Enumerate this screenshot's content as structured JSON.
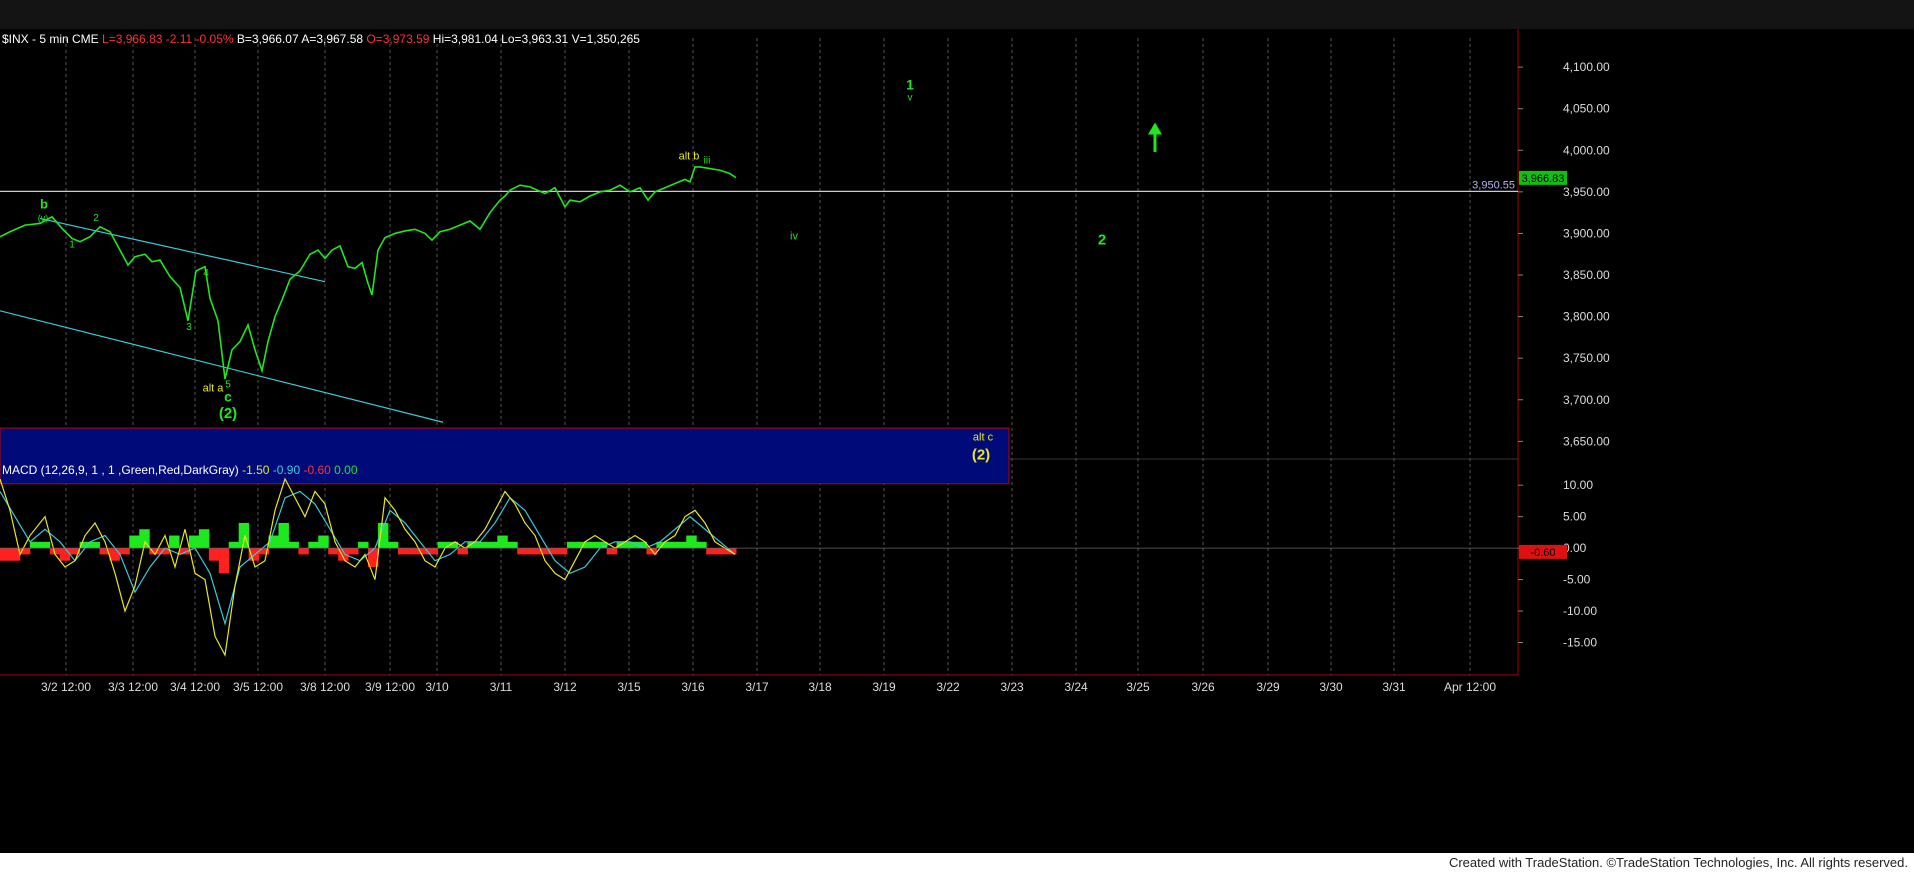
{
  "header": {
    "symbol": "$INX - 5 min  CME",
    "last": "L=3,966.83",
    "change": "-2.11",
    "change_pct": "-0.05%",
    "bid": "B=3,966.07",
    "ask": "A=3,967.58",
    "open": "O=3,973.59",
    "high": "Hi=3,981.04",
    "low": "Lo=3,963.31",
    "volume": "V=1,350,265"
  },
  "macd_header": {
    "name": "MACD (12,26,9, 1 , 1 ,Green,Red,DarkGray)",
    "v1": "-1.50",
    "v2": "-0.90",
    "v3": "-0.60",
    "v4": "0.00"
  },
  "footer": "Created with TradeStation. ©TradeStation Technologies, Inc. All rights reserved.",
  "colors": {
    "price": "#1ee81e",
    "yellow": "#e8e820",
    "red": "#ff2020",
    "cyan": "#3cc8dc",
    "hline": "#c8c8dc",
    "blue_zone": "#000a78",
    "blue_zone_border": "#c00000",
    "grid": "#555",
    "axis_text": "#dcdcdc"
  },
  "chart_data": [
    {
      "type": "line",
      "title": "$INX - 5 min",
      "y_ticks": [
        "4,100.00",
        "4,050.00",
        "4,000.00",
        "3,950.00",
        "3,900.00",
        "3,850.00",
        "3,800.00",
        "3,750.00",
        "3,700.00",
        "3,650.00"
      ],
      "ylim": [
        3630,
        4135
      ],
      "x_ticks": [
        "3/2 12:00",
        "3/3 12:00",
        "3/4 12:00",
        "3/5 12:00",
        "3/8 12:00",
        "3/9 12:00",
        "3/10",
        "3/11",
        "3/12",
        "3/15",
        "3/16",
        "3/17",
        "3/18",
        "3/19",
        "3/22",
        "3/23",
        "3/24",
        "3/25",
        "3/26",
        "3/29",
        "3/30",
        "3/31",
        "Apr 12:00"
      ],
      "series": [
        {
          "x": [
            0,
            10,
            25,
            40,
            52,
            62,
            72,
            80,
            90,
            100,
            110,
            120,
            128,
            135,
            145,
            152,
            160,
            170,
            180,
            188,
            196,
            205,
            210,
            218,
            225,
            232,
            240,
            248,
            255,
            262,
            268,
            275,
            282,
            290,
            300,
            310,
            318,
            325,
            332,
            340,
            348,
            355,
            362,
            368,
            372,
            378,
            385,
            395,
            405,
            415,
            425,
            432,
            440,
            450,
            460,
            470,
            480,
            490,
            500,
            505,
            510,
            520,
            530,
            545,
            555,
            565,
            570,
            580,
            590,
            600,
            610,
            620,
            630,
            640,
            648,
            655,
            665,
            675,
            685,
            690,
            695,
            700,
            710,
            720,
            730,
            736
          ],
          "y": [
            3896,
            3902,
            3910,
            3912,
            3920,
            3906,
            3894,
            3890,
            3896,
            3908,
            3902,
            3880,
            3862,
            3872,
            3875,
            3866,
            3868,
            3848,
            3835,
            3795,
            3855,
            3860,
            3822,
            3795,
            3725,
            3760,
            3770,
            3790,
            3760,
            3735,
            3770,
            3800,
            3820,
            3845,
            3855,
            3875,
            3880,
            3870,
            3880,
            3885,
            3860,
            3858,
            3865,
            3840,
            3826,
            3880,
            3895,
            3900,
            3903,
            3905,
            3900,
            3892,
            3902,
            3905,
            3910,
            3915,
            3905,
            3925,
            3940,
            3945,
            3952,
            3958,
            3956,
            3948,
            3955,
            3932,
            3940,
            3938,
            3945,
            3950,
            3952,
            3958,
            3950,
            3955,
            3940,
            3950,
            3955,
            3960,
            3965,
            3962,
            3980,
            3980,
            3978,
            3976,
            3972,
            3967
          ],
          "x_domain": [
            0,
            1515
          ]
        }
      ],
      "horizontal_line": 3950.55,
      "horizontal_line_label": "3,950.55",
      "last_price_label": "3,966.83",
      "channel_lines": [
        {
          "x": [
            40,
            325
          ],
          "y": [
            3918,
            3842
          ]
        },
        {
          "x": [
            0,
            443
          ],
          "y": [
            3807,
            3673
          ]
        }
      ],
      "target_zone": {
        "x": [
          0,
          1009
        ],
        "y": [
          3599,
          3666
        ]
      },
      "annotations": [
        {
          "text": "b",
          "x": 44,
          "y": 3930,
          "color": "green",
          "size": 13
        },
        {
          "text": "(v)",
          "x": 43,
          "y": 3915,
          "color": "green",
          "size": 9
        },
        {
          "text": "1",
          "x": 72,
          "y": 3883,
          "color": "green",
          "size": 10
        },
        {
          "text": "2",
          "x": 96,
          "y": 3915,
          "color": "green",
          "size": 10
        },
        {
          "text": "3",
          "x": 189,
          "y": 3784,
          "color": "green",
          "size": 10
        },
        {
          "text": "4",
          "x": 206,
          "y": 3849,
          "color": "green",
          "size": 10
        },
        {
          "text": "5",
          "x": 228,
          "y": 3715,
          "color": "green",
          "size": 10
        },
        {
          "text": "alt a",
          "x": 213,
          "y": 3710,
          "color": "yellow",
          "size": 11
        },
        {
          "text": "c",
          "x": 228,
          "y": 3698,
          "color": "green",
          "size": 14
        },
        {
          "text": "(2)",
          "x": 228,
          "y": 3678,
          "color": "green",
          "size": 15
        },
        {
          "text": "alt b",
          "x": 689,
          "y": 3989,
          "color": "yellow",
          "size": 11
        },
        {
          "text": "iii",
          "x": 707,
          "y": 3984,
          "color": "green",
          "size": 10
        },
        {
          "text": "iv",
          "x": 794,
          "y": 3893,
          "color": "green",
          "size": 11
        },
        {
          "text": "1",
          "x": 910,
          "y": 4073,
          "color": "green",
          "size": 14
        },
        {
          "text": "v",
          "x": 910,
          "y": 4060,
          "color": "green",
          "size": 10
        },
        {
          "text": "2",
          "x": 1102,
          "y": 3887,
          "color": "green",
          "size": 15
        },
        {
          "text": "alt c",
          "x": 983,
          "y": 3651,
          "color": "yellow",
          "size": 11
        },
        {
          "text": "(2)",
          "x": 981,
          "y": 3628,
          "color": "yellow",
          "size": 15
        }
      ],
      "up_arrow": {
        "x": 1155,
        "y_from": 3998,
        "y_to": 4031
      }
    },
    {
      "type": "line",
      "title": "MACD (12,26,9, 1 , 1 ,Green,Red,DarkGray)",
      "y_ticks": [
        "10.00",
        "5.00",
        "0.00",
        "-5.00",
        "-10.00",
        "-15.00"
      ],
      "ylim": [
        -20,
        14
      ],
      "series": [
        {
          "name": "MACD",
          "x": [
            0,
            10,
            20,
            30,
            45,
            55,
            65,
            75,
            85,
            95,
            105,
            115,
            125,
            135,
            145,
            155,
            165,
            175,
            185,
            195,
            205,
            215,
            225,
            235,
            245,
            255,
            265,
            275,
            285,
            295,
            305,
            315,
            325,
            335,
            345,
            355,
            365,
            375,
            385,
            395,
            405,
            415,
            425,
            435,
            445,
            455,
            465,
            475,
            485,
            495,
            505,
            515,
            525,
            535,
            545,
            555,
            565,
            575,
            585,
            595,
            605,
            615,
            625,
            635,
            645,
            655,
            665,
            675,
            685,
            695,
            705,
            715,
            725,
            735
          ],
          "y": [
            11,
            6,
            -1,
            2,
            5,
            -1,
            -3,
            -2,
            2,
            4,
            1,
            -4,
            -10,
            -6,
            1,
            -1,
            2,
            -3,
            3,
            -4,
            -5,
            -14,
            -17,
            -6,
            2,
            -3,
            -2,
            6,
            11,
            8,
            5,
            9,
            7,
            1,
            -2,
            -3,
            -1,
            -5,
            8,
            6,
            3,
            1,
            -2,
            -3,
            0,
            1,
            0,
            1,
            3,
            6,
            9,
            7,
            4,
            2,
            -2,
            -4,
            -5,
            -2,
            1,
            2,
            1,
            0,
            1,
            2,
            1,
            -1,
            1,
            2,
            5,
            6,
            4,
            1,
            0,
            -1
          ],
          "x_domain": [
            0,
            1515
          ]
        },
        {
          "name": "Signal",
          "x": [
            0,
            15,
            30,
            45,
            60,
            75,
            90,
            105,
            120,
            135,
            150,
            165,
            180,
            195,
            210,
            225,
            240,
            255,
            270,
            285,
            300,
            315,
            330,
            345,
            360,
            375,
            390,
            405,
            420,
            435,
            450,
            465,
            480,
            495,
            510,
            525,
            540,
            555,
            570,
            585,
            600,
            615,
            630,
            645,
            660,
            675,
            690,
            705,
            720,
            735
          ],
          "y": [
            9,
            5,
            1,
            3,
            1,
            -2,
            1,
            2,
            -1,
            -7,
            -3,
            0,
            -1,
            0,
            -4,
            -12,
            -3,
            -1,
            1,
            8,
            9,
            7,
            3,
            -1,
            -2,
            0,
            6,
            4,
            1,
            -2,
            -1,
            1,
            1,
            4,
            8,
            6,
            2,
            -2,
            -4,
            -3,
            0,
            1,
            1,
            0,
            1,
            3,
            5,
            3,
            1,
            -1
          ],
          "x_domain": [
            0,
            1515
          ]
        }
      ],
      "histogram": {
        "x_start": 0,
        "x_end": 736,
        "values": [
          -2,
          -2,
          -1,
          1,
          1,
          -1,
          -2,
          -1,
          1,
          1,
          -1,
          -2,
          -1,
          2,
          3,
          -1,
          -1,
          2,
          -1,
          2,
          3,
          -2,
          -4,
          1,
          4,
          -2,
          -1,
          2,
          4,
          1,
          -1,
          1,
          2,
          -1,
          -2,
          -1,
          1,
          -3,
          4,
          1,
          -1,
          -1,
          -1,
          -1,
          1,
          1,
          -1,
          1,
          1,
          1,
          2,
          1,
          -1,
          -1,
          -1,
          -1,
          -1,
          1,
          1,
          1,
          1,
          -1,
          1,
          1,
          1,
          -1,
          1,
          1,
          1,
          2,
          1,
          -1,
          -1,
          -1
        ]
      },
      "last_value_label": "-0.60"
    }
  ]
}
